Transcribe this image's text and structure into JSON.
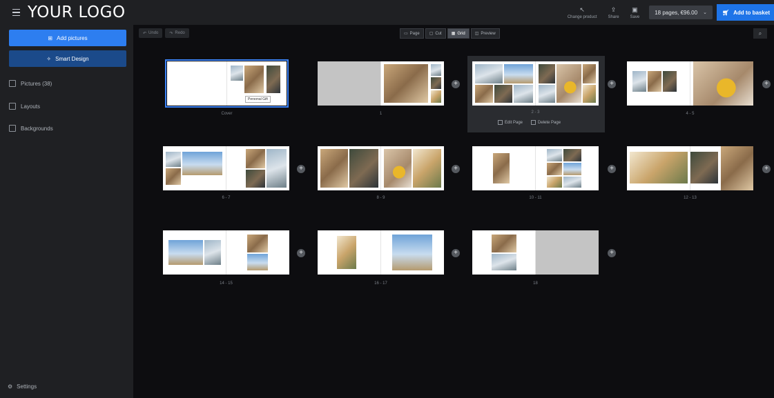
{
  "header": {
    "logo": "YOUR LOGO",
    "actions": [
      {
        "label": "Change product",
        "icon": "pointer-icon"
      },
      {
        "label": "Share",
        "icon": "share-icon"
      },
      {
        "label": "Save",
        "icon": "save-icon"
      }
    ],
    "pages_select": "18 pages, €96.00",
    "add_to_basket": "Add to basket"
  },
  "sidebar": {
    "add_pictures": "Add pictures",
    "smart_design": "Smart Design",
    "items": [
      {
        "label": "Pictures (38)",
        "icon": "pictures-icon"
      },
      {
        "label": "Layouts",
        "icon": "layouts-icon"
      },
      {
        "label": "Backgrounds",
        "icon": "backgrounds-icon"
      }
    ],
    "settings": "Settings"
  },
  "toolbar": {
    "undo": "Undo",
    "redo": "Redo",
    "views": [
      {
        "label": "Page",
        "active": false
      },
      {
        "label": "Cut",
        "active": false
      },
      {
        "label": "Grid",
        "active": true
      },
      {
        "label": "Preview",
        "active": false
      }
    ]
  },
  "spreads": [
    {
      "label": "Cover",
      "cover_text": "Personal Gift"
    },
    {
      "label": "1"
    },
    {
      "label": "2 - 3"
    },
    {
      "label": "4 - 5"
    },
    {
      "label": "6 - 7"
    },
    {
      "label": "8 - 9"
    },
    {
      "label": "10 - 11"
    },
    {
      "label": "12 - 13"
    },
    {
      "label": "14 - 15"
    },
    {
      "label": "16 - 17"
    },
    {
      "label": "18"
    }
  ],
  "hover_actions": {
    "edit": "Edit Page",
    "delete": "Delete Page"
  },
  "colors": {
    "accent": "#2d7ef0",
    "background": "#0d0d10",
    "panel": "#1f2023"
  }
}
